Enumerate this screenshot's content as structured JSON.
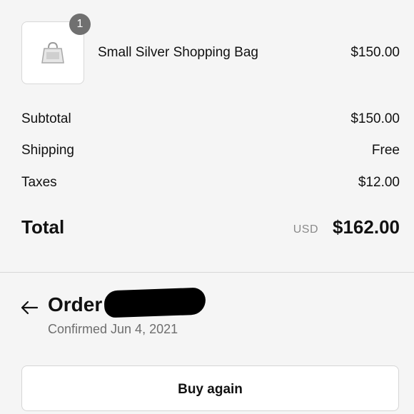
{
  "line_item": {
    "quantity": "1",
    "name": "Small Silver Shopping Bag",
    "price": "$150.00",
    "thumbnail_icon": "shopping-bag-icon"
  },
  "summary": {
    "subtotal_label": "Subtotal",
    "subtotal_value": "$150.00",
    "shipping_label": "Shipping",
    "shipping_value": "Free",
    "taxes_label": "Taxes",
    "taxes_value": "$12.00",
    "total_label": "Total",
    "total_currency": "USD",
    "total_value": "$162.00"
  },
  "order": {
    "back_icon": "arrow-left-icon",
    "title": "Order",
    "confirmed_text": "Confirmed Jun 4, 2021"
  },
  "actions": {
    "buy_again_label": "Buy again"
  },
  "colors": {
    "background": "#f5f5f5",
    "badge": "#707070",
    "muted_text": "#6e6e6e"
  }
}
